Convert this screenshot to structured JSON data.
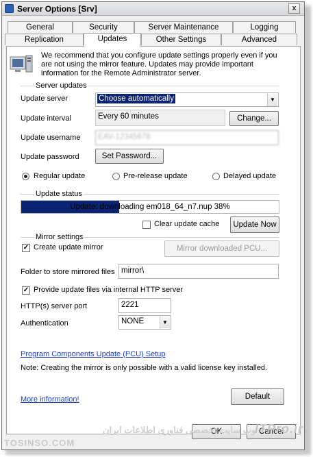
{
  "window": {
    "title": "Server Options [Srv]",
    "close_glyph": "x"
  },
  "tabs_row1": [
    "General",
    "Security",
    "Server Maintenance",
    "Logging"
  ],
  "tabs_row2": [
    "Replication",
    "Updates",
    "Other Settings",
    "Advanced"
  ],
  "active_tab": "Updates",
  "info": {
    "text": "We recommend that you configure update settings properly even if you are not using the mirror feature. Updates may provide important information for the Remote Administrator server."
  },
  "server_updates": {
    "heading": "Server updates",
    "update_server_label": "Update server",
    "update_server_value": "Choose automatically",
    "update_interval_label": "Update interval",
    "update_interval_value": "Every 60 minutes",
    "change_button": "Change...",
    "update_username_label": "Update username",
    "update_username_value": "EAV-12345678",
    "update_password_label": "Update password",
    "set_password_button": "Set Password...",
    "radio_regular": "Regular update",
    "radio_prerelease": "Pre-release update",
    "radio_delayed": "Delayed update"
  },
  "update_status": {
    "heading": "Update status",
    "progress_text": "Update: downloading em018_64_n7.nup 38%",
    "progress_percent": 38,
    "clear_cache_label": "Clear update cache",
    "update_now_button": "Update Now"
  },
  "mirror": {
    "heading": "Mirror settings",
    "create_mirror_label": "Create update mirror",
    "mirror_pcu_button": "Mirror downloaded PCU...",
    "folder_label": "Folder to store mirrored files",
    "folder_value": "mirror\\",
    "provide_http_label": "Provide update files via internal HTTP server",
    "http_port_label": "HTTP(s) server port",
    "http_port_value": "2221",
    "auth_label": "Authentication",
    "auth_value": "NONE"
  },
  "pcu_link": "Program Components Update (PCU) Setup",
  "note": "Note: Creating the mirror is only possible with a valid license key installed.",
  "more_info_link": "More information!",
  "default_button": "Default",
  "ok_button": "OK",
  "cancel_button": "Cancel",
  "watermark": {
    "site": "TOSINSO.COM",
    "brand": "ITPro.ir",
    "tagline": "وب سایت تخصصی فناوری اطلاعات ایران"
  }
}
